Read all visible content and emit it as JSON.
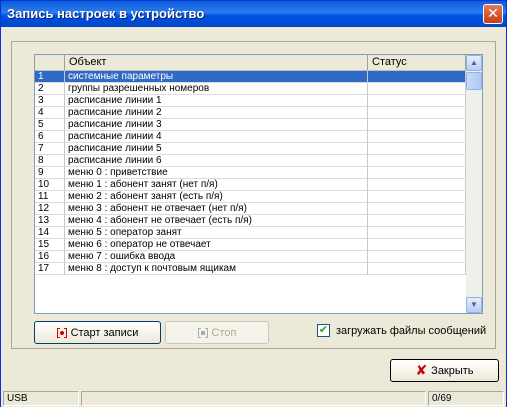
{
  "window": {
    "title": "Запись настроек в устройство",
    "close_glyph": "✕"
  },
  "list": {
    "columns": [
      "",
      "Объект",
      "Статус"
    ],
    "rows": [
      {
        "num": "1",
        "object": "системные параметры",
        "status": ""
      },
      {
        "num": "2",
        "object": "группы разрешенных номеров",
        "status": ""
      },
      {
        "num": "3",
        "object": "расписание линии 1",
        "status": ""
      },
      {
        "num": "4",
        "object": "расписание линии 2",
        "status": ""
      },
      {
        "num": "5",
        "object": "расписание линии 3",
        "status": ""
      },
      {
        "num": "6",
        "object": "расписание линии 4",
        "status": ""
      },
      {
        "num": "7",
        "object": "расписание линии 5",
        "status": ""
      },
      {
        "num": "8",
        "object": "расписание линии 6",
        "status": ""
      },
      {
        "num": "9",
        "object": "меню 0 : приветствие",
        "status": ""
      },
      {
        "num": "10",
        "object": "меню 1 : абонент занят (нет п/я)",
        "status": ""
      },
      {
        "num": "11",
        "object": "меню 2 : абонент занят (есть п/я)",
        "status": ""
      },
      {
        "num": "12",
        "object": "меню 3 : абонент не отвечает (нет п/я)",
        "status": ""
      },
      {
        "num": "13",
        "object": "меню 4 : абонент не отвечает (есть п/я)",
        "status": ""
      },
      {
        "num": "14",
        "object": "меню 5 : оператор занят",
        "status": ""
      },
      {
        "num": "15",
        "object": "меню 6 : оператор не отвечает",
        "status": ""
      },
      {
        "num": "16",
        "object": "меню 7 : ошибка ввода",
        "status": ""
      },
      {
        "num": "17",
        "object": "меню 8 : доступ к почтовым ящикам",
        "status": ""
      }
    ],
    "selected_index": 0,
    "selection_color": "#316ac5"
  },
  "controls": {
    "start_label": "Старт записи",
    "stop_label": "Стоп",
    "checkbox_label": "загружать файлы сообщений",
    "checkbox_checked": true,
    "close_label": "Закрыть"
  },
  "status": {
    "port": "USB",
    "progress": "0/69"
  }
}
